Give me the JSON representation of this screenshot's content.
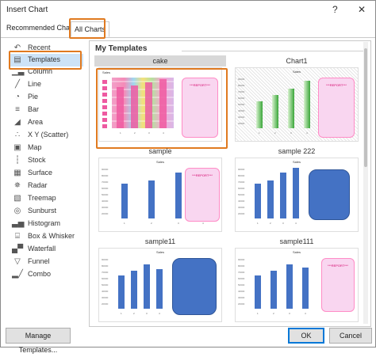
{
  "window": {
    "title": "Insert Chart",
    "help_label": "?",
    "close_label": "✕"
  },
  "tabs": [
    {
      "label": "Recommended Charts"
    },
    {
      "label": "All Charts"
    }
  ],
  "sidebar": {
    "items": [
      {
        "label": "Recent",
        "icon": "recent-icon",
        "glyph": "↶"
      },
      {
        "label": "Templates",
        "icon": "folder-icon",
        "glyph": "▤"
      },
      {
        "label": "Column",
        "icon": "column-chart-icon",
        "glyph": "▁▃"
      },
      {
        "label": "Line",
        "icon": "line-chart-icon",
        "glyph": "╱"
      },
      {
        "label": "Pie",
        "icon": "pie-chart-icon",
        "glyph": "◔"
      },
      {
        "label": "Bar",
        "icon": "bar-chart-icon",
        "glyph": "≡"
      },
      {
        "label": "Area",
        "icon": "area-chart-icon",
        "glyph": "◢"
      },
      {
        "label": "X Y (Scatter)",
        "icon": "scatter-chart-icon",
        "glyph": "∴"
      },
      {
        "label": "Map",
        "icon": "map-chart-icon",
        "glyph": "▣"
      },
      {
        "label": "Stock",
        "icon": "stock-chart-icon",
        "glyph": "┆"
      },
      {
        "label": "Surface",
        "icon": "surface-chart-icon",
        "glyph": "▦"
      },
      {
        "label": "Radar",
        "icon": "radar-chart-icon",
        "glyph": "✵"
      },
      {
        "label": "Treemap",
        "icon": "treemap-chart-icon",
        "glyph": "▧"
      },
      {
        "label": "Sunburst",
        "icon": "sunburst-chart-icon",
        "glyph": "◎"
      },
      {
        "label": "Histogram",
        "icon": "histogram-chart-icon",
        "glyph": "▃▅"
      },
      {
        "label": "Box & Whisker",
        "icon": "box-whisker-chart-icon",
        "glyph": "⌸"
      },
      {
        "label": "Waterfall",
        "icon": "waterfall-chart-icon",
        "glyph": "▄▀"
      },
      {
        "label": "Funnel",
        "icon": "funnel-chart-icon",
        "glyph": "▽"
      },
      {
        "label": "Combo",
        "icon": "combo-chart-icon",
        "glyph": "▂╱"
      }
    ]
  },
  "main": {
    "section_title": "My Templates",
    "chart_title": "Sales",
    "report_text": "***REPORT***",
    "y_ticks": [
      "90000",
      "80000",
      "70000",
      "60000",
      "50000",
      "40000",
      "30000",
      "20000",
      "10000",
      "0"
    ],
    "x_ticks": [
      "1",
      "2",
      "3",
      "4"
    ],
    "templates": [
      {
        "name": "cake"
      },
      {
        "name": "Chart1"
      },
      {
        "name": "sample"
      },
      {
        "name": "sample 222"
      },
      {
        "name": "sample11"
      },
      {
        "name": "sample111"
      }
    ]
  },
  "footer": {
    "manage_label": "Manage Templates...",
    "ok_label": "OK",
    "cancel_label": "Cancel"
  },
  "colors": {
    "accent_focus": "#e07a20",
    "bar_blue": "#4472c4",
    "bar_green": "#3aa63a",
    "report_pink": "#f9d6f0",
    "selection": "#cde3f7"
  }
}
